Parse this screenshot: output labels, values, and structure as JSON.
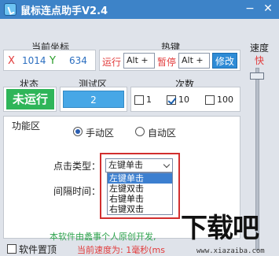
{
  "window": {
    "title": "鼠标连点助手V2.4",
    "min_glyph": "−",
    "close_glyph": "✕"
  },
  "coords": {
    "section_title": "当前坐标",
    "x_label": "X",
    "x_value": "1014",
    "y_label": "Y",
    "y_value": "634"
  },
  "hotkey": {
    "section_title": "热键",
    "run_label": "运行",
    "run_value": "Alt +",
    "pause_label": "暂停",
    "pause_value": "Alt +",
    "modify_label": "修改"
  },
  "speed": {
    "section_title": "速度",
    "value_label": "快"
  },
  "status": {
    "section_title": "状态",
    "value": "未运行",
    "color": "#2fb559"
  },
  "test": {
    "section_title": "测试区",
    "count": "2"
  },
  "times": {
    "section_title": "次数",
    "options": [
      {
        "label": "1",
        "checked": false
      },
      {
        "label": "10",
        "checked": true
      },
      {
        "label": "100",
        "checked": false
      }
    ]
  },
  "function": {
    "section_title": "功能区",
    "manual_label": "手动区",
    "auto_label": "自动区",
    "click_type_label": "点击类型：",
    "click_type_value": "左键单击",
    "interval_label": "间隔时间：",
    "dropdown_options": [
      "左键单击",
      "左键双击",
      "右键单击",
      "右键双击"
    ]
  },
  "footer": {
    "note": "本软件由蠡事个人原创开发,",
    "speed_line": "当前速度为: 1毫秒(ms",
    "always_on_top_label": "软件置顶"
  },
  "watermark": {
    "big": "下载吧",
    "small": "www.xiazaiba.com"
  }
}
